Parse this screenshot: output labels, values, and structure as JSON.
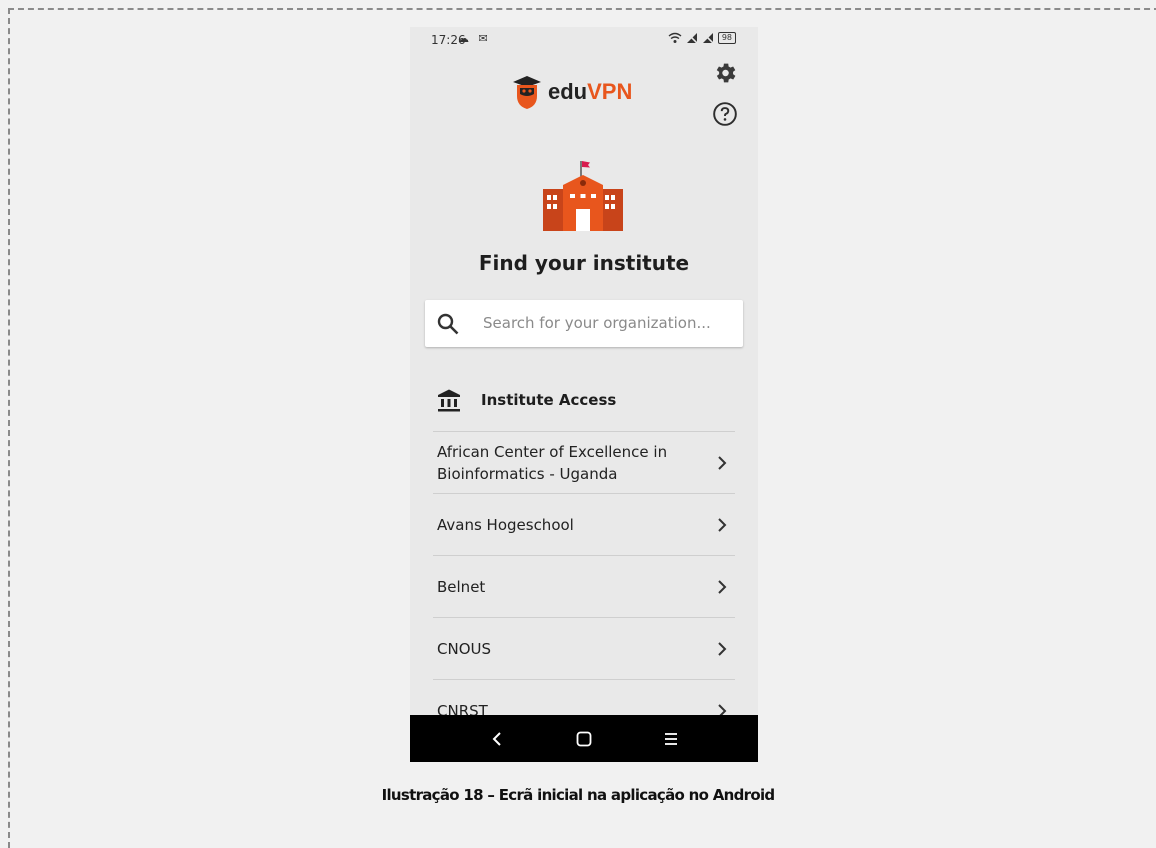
{
  "status_bar": {
    "time": "17:26",
    "battery": "98",
    "left_icons": "☁ ✉"
  },
  "app": {
    "logo_edu": "edu",
    "logo_vpn": "VPN"
  },
  "colors": {
    "accent": "#e8561d",
    "background": "#e9e9e9",
    "navbar": "#000000"
  },
  "main": {
    "title": "Find your institute",
    "search": {
      "placeholder": "Search for your organization...",
      "value": ""
    },
    "section_title": "Institute Access",
    "institutes": [
      {
        "name": "African Center of Excellence in Bioinformatics - Uganda"
      },
      {
        "name": "Avans Hogeschool"
      },
      {
        "name": "Belnet"
      },
      {
        "name": "CNOUS"
      },
      {
        "name": "CNRST"
      }
    ]
  },
  "caption": "Ilustração 18 – Ecrã inicial na aplicação no Android"
}
